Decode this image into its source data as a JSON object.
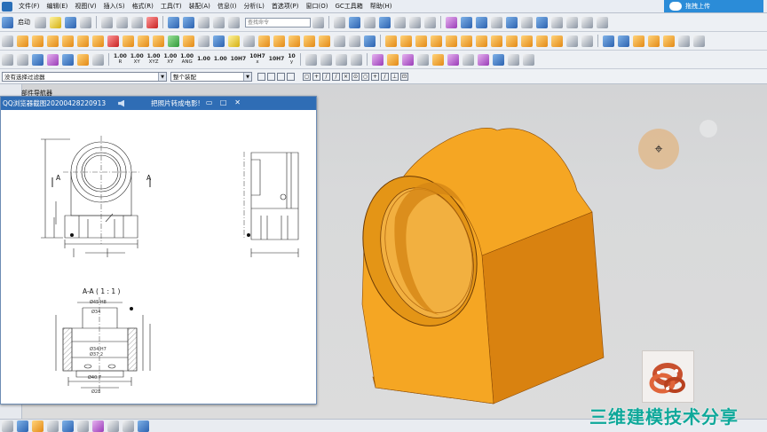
{
  "menubar": {
    "items": [
      "文件(F)",
      "编辑(E)",
      "视图(V)",
      "插入(S)",
      "格式(R)",
      "工具(T)",
      "装配(A)",
      "信息(I)",
      "分析(L)",
      "首选项(P)",
      "窗口(O)",
      "GC工具箱",
      "帮助(H)"
    ],
    "upload_label": "拖拽上传"
  },
  "toolbar1": {
    "start_label": "启动",
    "command_search_placeholder": "查找命令"
  },
  "toolbar3": {
    "numeric_tools": [
      {
        "top": "1.00",
        "bottom": "R"
      },
      {
        "top": "1.00",
        "bottom": "XY"
      },
      {
        "top": "1.00",
        "bottom": "XYZ"
      },
      {
        "top": "1.00",
        "bottom": "XY"
      },
      {
        "top": "1.00",
        "bottom": "ANG"
      },
      {
        "top": "1.00",
        "bottom": ""
      },
      {
        "top": "1.00",
        "bottom": ""
      },
      {
        "top": "10H7",
        "bottom": ""
      },
      {
        "top": "10H7",
        "bottom": "x"
      },
      {
        "top": "10H7",
        "bottom": ""
      },
      {
        "top": "10",
        "bottom": "y"
      }
    ]
  },
  "selection_bar": {
    "filter_value": "没有选择过滤器",
    "assembly_value": "整个装配"
  },
  "navigator": {
    "title": "部件导航器"
  },
  "viewer_window": {
    "title": "QQ浏览器截图20200428220913",
    "subtitle": "把照片转成电影!",
    "minimize": "▭",
    "maximize": "□",
    "close": "✕"
  },
  "drawing": {
    "arrow_label_left": "A",
    "arrow_label_right": "A",
    "section_view_label": "A-A ( 1 : 1 )",
    "diameter_labels": [
      "Ø45 H8",
      "Ø34",
      "Ø34 H7",
      "Ø37.2",
      "Ø40.7",
      "Ø28"
    ]
  },
  "watermark": {
    "text": "三维建模技术分享"
  },
  "colors": {
    "part_face": "#f5a623",
    "part_shadow": "#d98210",
    "part_bore": "#e49516",
    "viewport_bg": "#d6d7d8",
    "titlebar": "#2f6db5",
    "watermark": "#0ea89a"
  }
}
